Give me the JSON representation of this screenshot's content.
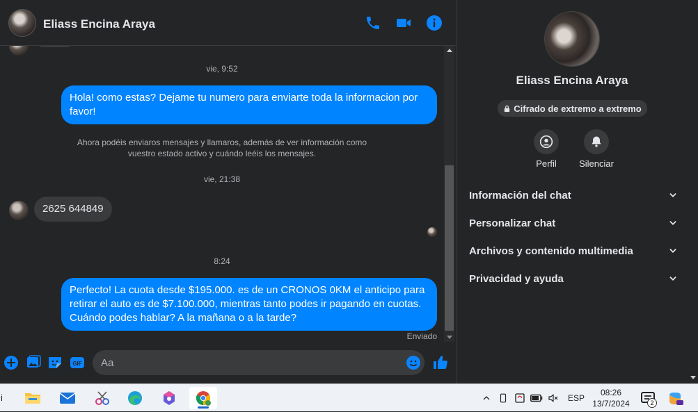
{
  "header": {
    "contact_name": "Eliass Encina Araya",
    "icons": [
      "phone-icon",
      "video-camera-icon",
      "info-icon"
    ]
  },
  "messages": {
    "ts1": "vie, 9:52",
    "msg1": "Hola! como estas? Dejame tu numero para enviarte toda la informacion por favor!",
    "system_note": "Ahora podéis enviaros mensajes y llamaros, además de ver información como vuestro estado activo y cuándo leéis los mensajes.",
    "ts2": "vie, 21:38",
    "msg2": "2625 644849",
    "ts3": "8:24",
    "msg3": "Perfecto! La cuota desde $195.000. es de un CRONOS 0KM el anticipo para retirar el auto es de $7.100.000, mientras tanto podes ir pagando en cuotas. Cuándo podes hablar? A la mañana o a la tarde?",
    "status": "Enviado"
  },
  "composer": {
    "placeholder": "Aa"
  },
  "side": {
    "name": "Eliass Encina Araya",
    "e2e_label": "Cifrado de extremo a extremo",
    "actions": {
      "profile": "Perfil",
      "mute": "Silenciar"
    },
    "sections": [
      "Información del chat",
      "Personalizar chat",
      "Archivos y contenido multimedia",
      "Privacidad y ayuda"
    ]
  },
  "taskbar": {
    "left_char": "i",
    "lang": "ESP",
    "time": "08:26",
    "date": "13/7/2024",
    "notification_count": "2"
  },
  "colors": {
    "accent": "#0084ff",
    "background": "#242526",
    "bubble_in": "#3a3b3c"
  }
}
